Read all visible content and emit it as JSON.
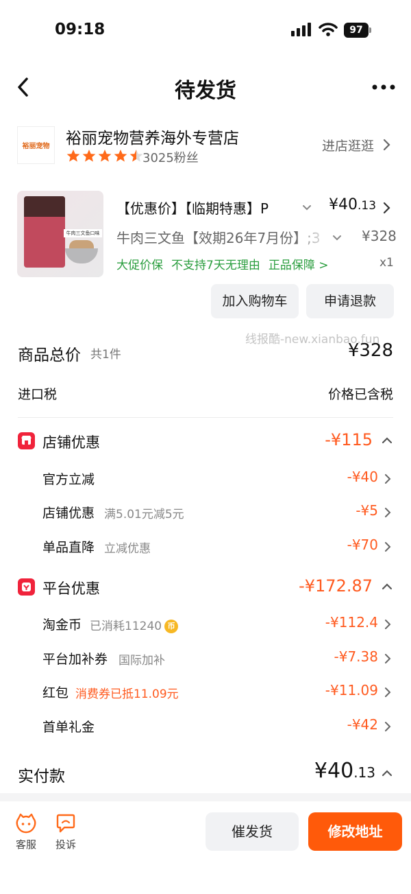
{
  "status_bar": {
    "time": "09:18",
    "battery": "97"
  },
  "nav": {
    "title": "待发货"
  },
  "store": {
    "logo_text": "裕丽宠物",
    "name": "裕丽宠物营养海外专营店",
    "rating": 4.5,
    "fans": "3025粉丝",
    "visit_label": "进店逛逛"
  },
  "product": {
    "title": "【优惠价】【临期特惠】P",
    "variant": "牛肉三文鱼【效期26年7月份】;3",
    "price_main": "¥40",
    "price_decimal": ".13",
    "original_price": "¥328",
    "guarantees": [
      "大促价保",
      "不支持7天无理由",
      "正品保障 >"
    ],
    "quantity": "x1",
    "image_tag": "牛肉三文鱼口味",
    "add_to_cart": "加入购物车",
    "refund": "申请退款"
  },
  "watermark": "线报酷-new.xianbao.fun",
  "totals": {
    "label": "商品总价",
    "count": "共1件",
    "value": "¥328",
    "tax_label": "进口税",
    "tax_value": "价格已含税"
  },
  "store_discount": {
    "label": "店铺优惠",
    "value": "-¥115",
    "items": [
      {
        "label": "官方立减",
        "note": "",
        "value": "-¥40"
      },
      {
        "label": "店铺优惠",
        "note": "满5.01元减5元",
        "value": "-¥5"
      },
      {
        "label": "单品直降",
        "note": "立减优惠",
        "value": "-¥70"
      }
    ]
  },
  "platform_discount": {
    "label": "平台优惠",
    "value": "-¥172.87",
    "items": [
      {
        "label": "淘金币",
        "note": "已消耗11240",
        "value": "-¥112.4"
      },
      {
        "label": "平台加补券",
        "note": "国际加补",
        "value": "-¥7.38"
      },
      {
        "label": "红包",
        "note": "消费券已抵11.09元",
        "value": "-¥11.09"
      },
      {
        "label": "首单礼金",
        "note": "",
        "value": "-¥42"
      }
    ]
  },
  "paid": {
    "label": "实付款",
    "value_main": "¥40",
    "value_decimal": ".13"
  },
  "bottom": {
    "service": "客服",
    "complain": "投诉",
    "urge": "催发货",
    "change_address": "修改地址"
  },
  "colors": {
    "accent": "#ff5a0a",
    "discount": "#ff5a1f",
    "green": "#2a9d3e",
    "badge_red": "#f0233b"
  }
}
